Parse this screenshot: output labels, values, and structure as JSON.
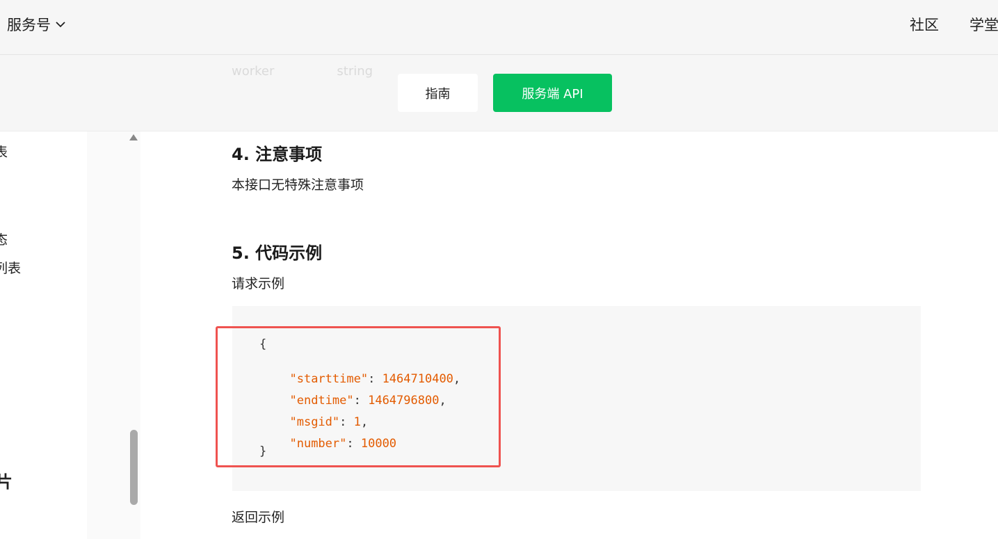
{
  "header": {
    "brand": "服务号",
    "nav": [
      "社区",
      "学堂"
    ]
  },
  "band": {
    "ghost_text": [
      "worker",
      "string"
    ],
    "tabs": [
      {
        "label": "指南",
        "active": false
      },
      {
        "label": "服务端 API",
        "active": true
      }
    ],
    "accent_color": "#07c160"
  },
  "sidebar": {
    "items": [
      "表",
      "态",
      "列表"
    ],
    "heading": "片"
  },
  "content": {
    "section4_title": "4. 注意事项",
    "section4_text": "本接口无特殊注意事项",
    "section5_title": "5. 代码示例",
    "request_label": "请求示例",
    "response_label": "返回示例",
    "code": {
      "open": "{",
      "close": "}",
      "fields": [
        {
          "key": "\"starttime\"",
          "value": "1464710400",
          "trail": ","
        },
        {
          "key": "\"endtime\"",
          "value": "1464796800",
          "trail": ","
        },
        {
          "key": "\"msgid\"",
          "value": "1",
          "trail": ","
        },
        {
          "key": "\"number\"",
          "value": "10000",
          "trail": ""
        }
      ]
    },
    "highlight_color": "#ef5350"
  }
}
